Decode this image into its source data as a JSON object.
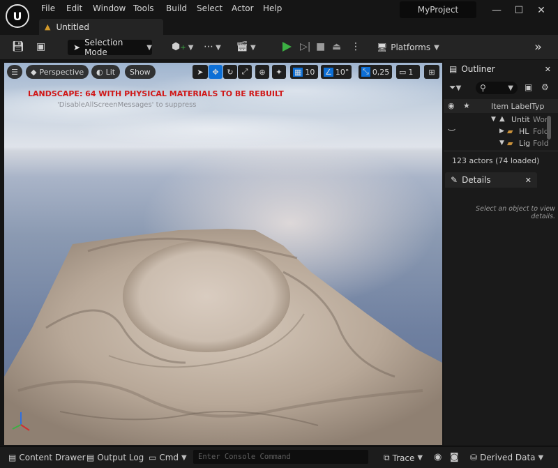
{
  "app": {
    "project_name": "MyProject",
    "document_tab": "Untitled"
  },
  "menu": [
    "File",
    "Edit",
    "Window",
    "Tools",
    "Build",
    "Select",
    "Actor",
    "Help"
  ],
  "toolbar": {
    "selection_mode": "Selection Mode",
    "platforms": "Platforms"
  },
  "viewport": {
    "perspective": "Perspective",
    "lit": "Lit",
    "show": "Show",
    "grid_snap": "10",
    "rotation_snap": "10°",
    "scale_snap": "0,25",
    "camera_speed": "1",
    "warning": "LANDSCAPE: 64  WITH PHYSICAL MATERIALS  TO BE REBUILT",
    "suppress_hint": "'DisableAllScreenMessages' to suppress"
  },
  "outliner": {
    "title": "Outliner",
    "col_label": "Item Label",
    "col_type": "Typ",
    "rows": [
      {
        "label": "Untit",
        "type": "Wor"
      },
      {
        "label": "HL",
        "type": "Fold"
      },
      {
        "label": "Lig",
        "type": "Fold"
      }
    ],
    "actor_count": "123 actors (74 loaded)"
  },
  "details": {
    "title": "Details",
    "empty_message": "Select an object to view details."
  },
  "statusbar": {
    "content_drawer": "Content Drawer",
    "output_log": "Output Log",
    "cmd": "Cmd",
    "console_placeholder": "Enter Console Command",
    "trace": "Trace",
    "derived_data": "Derived Data"
  },
  "colors": {
    "accent_blue": "#0d6fd6",
    "play_green": "#3cb043",
    "warning_red": "#d01818",
    "folder": "#c9913a"
  }
}
